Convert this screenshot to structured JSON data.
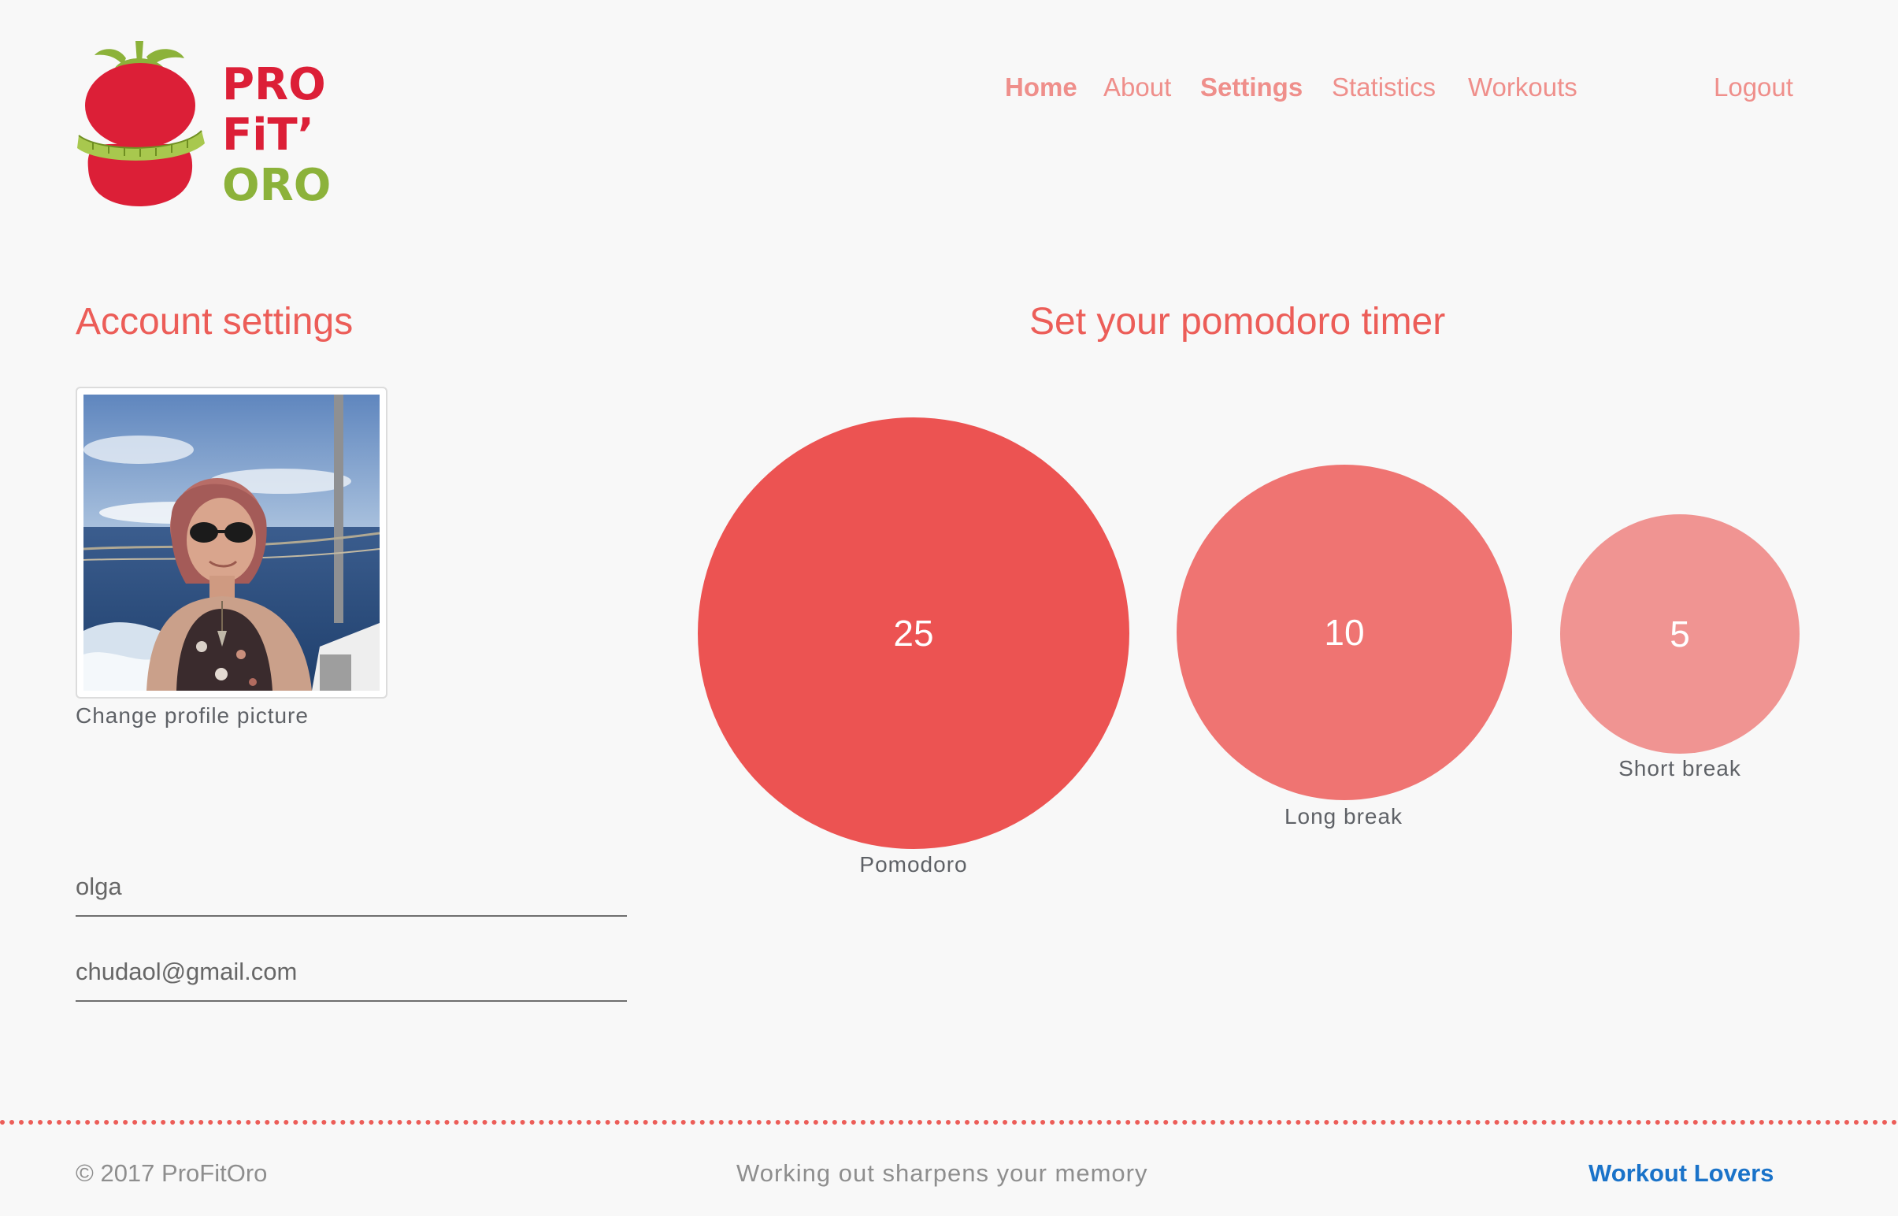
{
  "brand": {
    "logo_word_1": "PRO",
    "logo_word_2": "FiT’",
    "logo_word_3": "ORO",
    "colors": {
      "red": "#dc1f37",
      "green": "#8cb23a"
    }
  },
  "nav": {
    "home": "Home",
    "about": "About",
    "settings": "Settings",
    "statistics": "Statistics",
    "workouts": "Workouts",
    "logout": "Logout"
  },
  "account": {
    "title": "Account settings",
    "change_picture_label": "Change profile picture",
    "username": "olga",
    "email": "chudaol@gmail.com"
  },
  "timer": {
    "title": "Set your pomodoro timer",
    "pomodoro": {
      "value": "25",
      "label": "Pomodoro",
      "color": "#ec5352"
    },
    "long_break": {
      "value": "10",
      "label": "Long break",
      "color": "#ef7472"
    },
    "short_break": {
      "value": "5",
      "label": "Short break",
      "color": "#f09492"
    }
  },
  "footer": {
    "copyright": "© 2017 ProFitOro",
    "tagline": "Working out sharpens your memory",
    "credit": "Workout Lovers",
    "colors": {
      "credit": "#1a73c9",
      "muted": "#8e8e8e"
    }
  }
}
